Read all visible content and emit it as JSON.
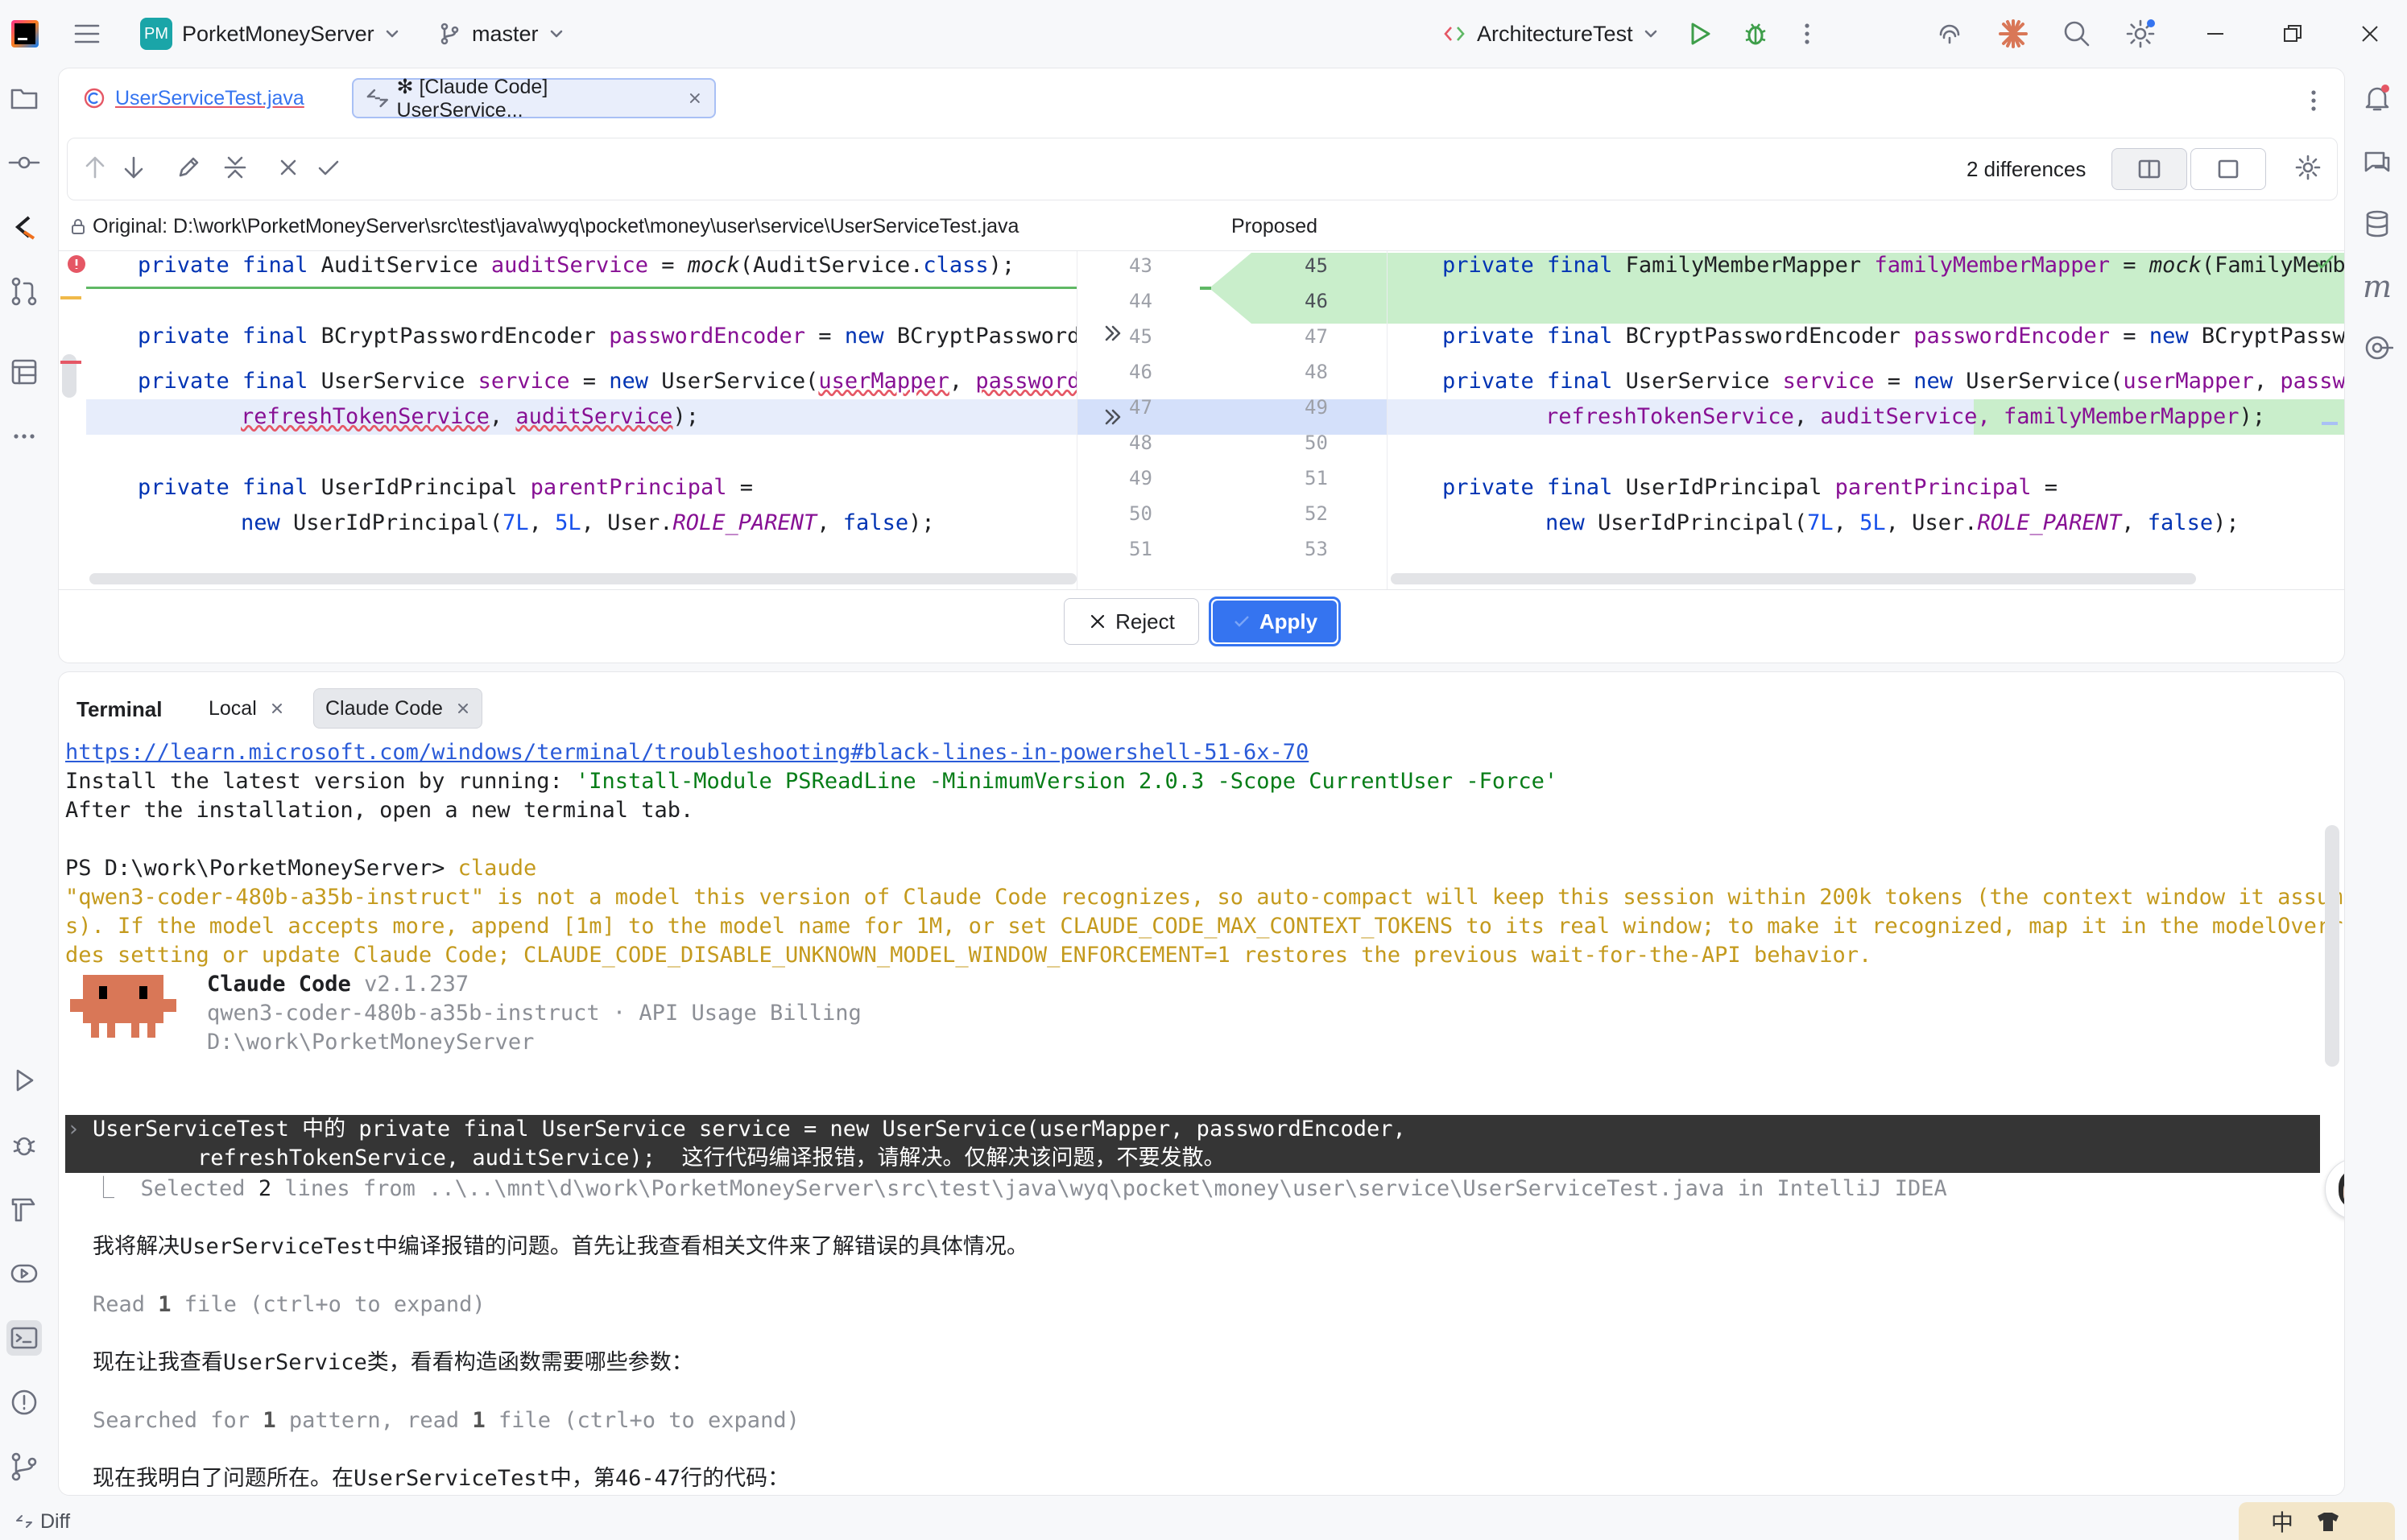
{
  "titlebar": {
    "project_badge": "PM",
    "project_name": "PorketMoneyServer",
    "branch": "master",
    "run_config": "ArchitectureTest"
  },
  "editor": {
    "tabs": [
      {
        "label": "UserServiceTest.java"
      },
      {
        "label": "✻ [Claude Code] UserService..."
      }
    ],
    "differences_label": "2 differences",
    "original_path": "Original: D:\\work\\PorketMoneyServer\\src\\test\\java\\wyq\\pocket\\money\\user\\service\\UserServiceTest.java",
    "proposed_label": "Proposed",
    "left_gutter": [
      "43",
      "44",
      "45",
      "46",
      "47",
      "48",
      "49",
      "50",
      "51"
    ],
    "right_gutter": [
      "45",
      "46",
      "47",
      "48",
      "49",
      "50",
      "51",
      "52",
      "53"
    ],
    "left_code": {
      "l1": {
        "kw1": "private final ",
        "type": "AuditService ",
        "field": "auditService",
        "rest": " = ",
        "call": "mock",
        "args": "(AuditService.",
        "cls": "class",
        "end": ");"
      },
      "l2": {
        "kw1": "private final ",
        "type": "BCryptPasswordEncoder ",
        "field": "passwordEncoder",
        "rest": " = ",
        "kw2": "new ",
        "end": "BCryptPasswordE"
      },
      "l3": {
        "kw1": "private final ",
        "type": "UserService ",
        "field": "service",
        "rest": " = ",
        "kw2": "new ",
        "ctor": "UserService(",
        "arg1": "userMapper",
        "sep": ", ",
        "arg2": "passwordE"
      },
      "l4": {
        "a1": "refreshTokenService",
        "sep": ", ",
        "a2": "auditService",
        "end": ");"
      },
      "l5": {
        "kw1": "private final ",
        "type": "UserIdPrincipal ",
        "field": "parentPrincipal",
        "rest": " ="
      },
      "l6": {
        "kw2": "new ",
        "ctor": "UserIdPrincipal(",
        "n1": "7L",
        "sep1": ", ",
        "n2": "5L",
        "sep2": ", User.",
        "const": "ROLE_PARENT",
        "sep3": ", ",
        "kw3": "false",
        "end": ");"
      }
    },
    "right_code": {
      "l1": {
        "kw1": "private final ",
        "type": "FamilyMemberMapper ",
        "field": "familyMemberMapper",
        "rest": " = ",
        "call": "mock",
        "args": "(FamilyMemberMapp"
      },
      "l2": {
        "kw1": "private final ",
        "type": "BCryptPasswordEncoder ",
        "field": "passwordEncoder",
        "rest": " = ",
        "kw2": "new ",
        "end": "BCryptPasswordEnc"
      },
      "l3": {
        "kw1": "private final ",
        "type": "UserService ",
        "field": "service",
        "rest": " = ",
        "kw2": "new ",
        "ctor": "UserService(",
        "arg1": "userMapper",
        "sep": ", ",
        "arg2": "passwordEnc"
      },
      "l4": {
        "a1": "refreshTokenService",
        "sep": ", ",
        "a2": "auditService",
        "a3": ", familyMemberMapper",
        "end": ");"
      },
      "l5": {
        "kw1": "private final ",
        "type": "UserIdPrincipal ",
        "field": "parentPrincipal",
        "rest": " ="
      },
      "l6": {
        "kw2": "new ",
        "ctor": "UserIdPrincipal(",
        "n1": "7L",
        "sep1": ", ",
        "n2": "5L",
        "sep2": ", User.",
        "const": "ROLE_PARENT",
        "sep3": ", ",
        "kw3": "false",
        "end": ");"
      }
    },
    "reject_label": "Reject",
    "apply_label": "Apply"
  },
  "terminal": {
    "title": "Terminal",
    "tabs": [
      {
        "label": "Local"
      },
      {
        "label": "Claude Code"
      }
    ],
    "link": "https://learn.microsoft.com/windows/terminal/troubleshooting#black-lines-in-powershell-51-6x-70",
    "install_prefix": "Install the latest version by running: ",
    "install_cmd": "'Install-Module PSReadLine -MinimumVersion 2.0.3 -Scope CurrentUser -Force'",
    "after_install": "After the installation, open a new terminal tab.",
    "prompt": "PS D:\\work\\PorketMoneyServer> ",
    "prompt_cmd": "claude",
    "warn1": "\"qwen3-coder-480b-a35b-instruct\" is not a model this version of Claude Code recognizes, so auto-compact will keep this session within 200k tokens (the context window it assume",
    "warn2": "s). If the model accepts more, append [1m] to the model name for 1M, or set CLAUDE_CODE_MAX_CONTEXT_TOKENS to its real window; to make it recognized, map it in the modelOverri",
    "warn3": "des setting or update Claude Code; CLAUDE_CODE_DISABLE_UNKNOWN_MODEL_WINDOW_ENFORCEMENT=1 restores the previous wait-for-the-API behavior.",
    "cc_name": "Claude Code",
    "cc_version": " v2.1.237",
    "cc_model": "qwen3-coder-480b-a35b-instruct · API Usage Billing",
    "cc_dir": "D:\\work\\PorketMoneyServer",
    "input_marker": "›",
    "user_msg1": "UserServiceTest 中的 private final UserService service = new UserService(userMapper, passwordEncoder,",
    "user_msg2": "        refreshTokenService, auditService);  这行代码编译报错，请解决。仅解决该问题，不要发散。",
    "selected_prefix": "⎿  ",
    "selected_pre": "Selected ",
    "selected_count": "2",
    "selected_post": " lines from ..\\..\\mnt\\d\\work\\PorketMoneyServer\\src\\test\\java\\wyq\\pocket\\money\\user\\service\\UserServiceTest.java in IntelliJ IDEA",
    "resp1": "我将解决UserServiceTest中编译报错的问题。首先让我查看相关文件来了解错误的具体情况。",
    "read_pre": "Read ",
    "read_count": "1",
    "read_post": " file (ctrl+o to expand)",
    "resp2": "现在让我查看UserService类，看看构造函数需要哪些参数：",
    "search_pre": "Searched for ",
    "search_n1": "1",
    "search_mid": " pattern, read ",
    "search_n2": "1",
    "search_post": " file (ctrl+o to expand)",
    "resp3": "现在我明白了问题所在。在UserServiceTest中，第46-47行的代码："
  },
  "statusbar": {
    "label": "Diff",
    "ime": "中"
  },
  "colors": {
    "accent": "#3574f0",
    "added_bg": "#c9eecb",
    "changed_bg": "#e7edfb",
    "terminal_warn": "#c49a1d",
    "link": "#2a5bd8"
  }
}
